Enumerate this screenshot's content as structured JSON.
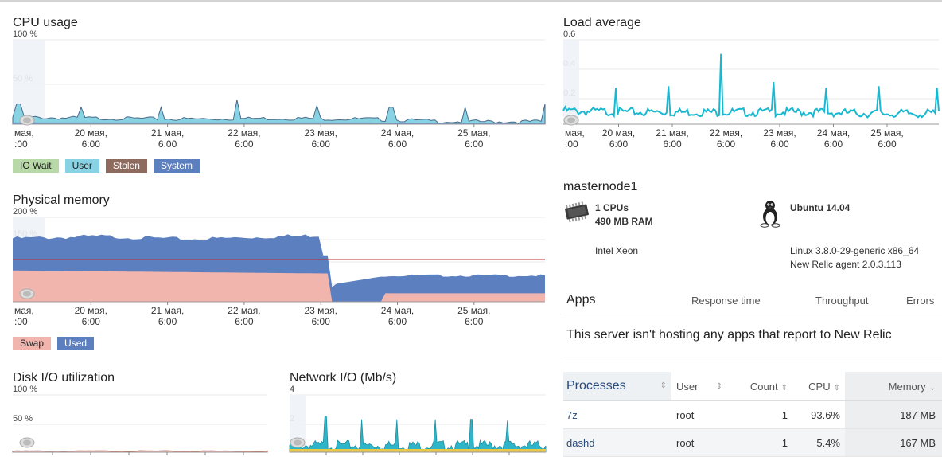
{
  "cpu": {
    "title": "CPU usage",
    "y_ticks": [
      "100 %",
      "50 %"
    ],
    "legend": [
      {
        "label": "IO Wait",
        "color": "#b7d9a7"
      },
      {
        "label": "User",
        "color": "#87d3e3"
      },
      {
        "label": "Stolen",
        "color": "#8e6b5f"
      },
      {
        "label": "System",
        "color": "#5c7fbf"
      }
    ]
  },
  "x_axis": {
    "row1": [
      "мая,",
      "20 мая,",
      "21 мая,",
      "22 мая,",
      "23 мая,",
      "24 мая,",
      "25 мая,"
    ],
    "row2": [
      ":00",
      "6:00",
      "6:00",
      "6:00",
      "6:00",
      "6:00",
      "6:00"
    ]
  },
  "memory": {
    "title": "Physical memory",
    "y_ticks": [
      "200 %",
      "150 %",
      "100 %",
      "50 %"
    ],
    "legend": [
      {
        "label": "Swap",
        "color": "#f2b5ae"
      },
      {
        "label": "Used",
        "color": "#5c7fbf"
      }
    ]
  },
  "disk": {
    "title": "Disk I/O utilization",
    "y_ticks": [
      "100 %",
      "50 %"
    ]
  },
  "network": {
    "title": "Network I/O (Mb/s)",
    "y_ticks": [
      "4",
      "2"
    ]
  },
  "load": {
    "title": "Load average",
    "y_ticks": [
      "0.6",
      "0.4",
      "0.2"
    ]
  },
  "host": {
    "name": "masternode1",
    "cpus": "1 CPUs",
    "ram": "490 MB RAM",
    "os": "Ubuntu 14.04",
    "processor": "Intel Xeon",
    "kernel": "Linux 3.8.0-29-generic x86_64",
    "agent": "New Relic agent 2.0.3.113",
    "cpu_icon": "cpu-chip-icon",
    "os_icon": "linux-penguin-icon"
  },
  "apps": {
    "title": "Apps",
    "columns": [
      "Response time",
      "Throughput",
      "Errors"
    ],
    "message": "This server isn't hosting any apps that report to New Relic"
  },
  "processes": {
    "headers": [
      "Processes",
      "User",
      "Count",
      "CPU",
      "Memory"
    ],
    "rows": [
      {
        "name": "7z",
        "user": "root",
        "count": "1",
        "cpu": "93.6%",
        "memory": "187 MB"
      },
      {
        "name": "dashd",
        "user": "root",
        "count": "1",
        "cpu": "5.4%",
        "memory": "167 MB"
      }
    ]
  },
  "chart_data": [
    {
      "type": "area",
      "title": "CPU usage",
      "ylim": [
        0,
        100
      ],
      "y_unit": "%",
      "x": [
        "19 мая 6:00",
        "20 мая 6:00",
        "21 мая 6:00",
        "22 мая 6:00",
        "23 мая 6:00",
        "24 мая 6:00",
        "25 мая 6:00"
      ],
      "series": [
        {
          "name": "User",
          "values": [
            8,
            7,
            6,
            7,
            6,
            3,
            3
          ]
        },
        {
          "name": "System",
          "values": [
            2,
            2,
            2,
            2,
            2,
            1,
            1
          ]
        }
      ],
      "spikes_percent": [
        24,
        20,
        20,
        29,
        22,
        20,
        20,
        24
      ]
    },
    {
      "type": "area",
      "title": "Physical memory",
      "ylim": [
        0,
        200
      ],
      "y_unit": "%",
      "reference_line": 100,
      "x": [
        "19 мая 6:00",
        "20 мая 6:00",
        "21 мая 6:00",
        "22 мая 6:00",
        "23 мая 6:00",
        "24 мая 6:00",
        "25 мая 6:00"
      ],
      "series": [
        {
          "name": "Used",
          "values": [
            150,
            155,
            148,
            155,
            160,
            35,
            68
          ]
        },
        {
          "name": "Swap",
          "values": [
            74,
            72,
            70,
            68,
            66,
            0,
            20
          ]
        }
      ]
    },
    {
      "type": "line",
      "title": "Load average",
      "ylim": [
        0,
        0.6
      ],
      "x": [
        "19 мая 6:00",
        "20 мая 6:00",
        "21 мая 6:00",
        "22 мая 6:00",
        "23 мая 6:00",
        "24 мая 6:00",
        "25 мая 6:00"
      ],
      "series": [
        {
          "values": [
            0.08,
            0.07,
            0.07,
            0.07,
            0.07,
            0.06,
            0.06
          ]
        }
      ],
      "spikes": [
        0.26,
        0.27,
        0.5,
        0.3,
        0.26,
        0.27,
        0.26
      ]
    },
    {
      "type": "area",
      "title": "Disk I/O utilization",
      "ylim": [
        0,
        100
      ],
      "y_unit": "%",
      "series": [
        {
          "values": [
            2,
            2,
            2,
            2,
            2,
            2,
            2
          ]
        }
      ]
    },
    {
      "type": "area",
      "title": "Network I/O (Mb/s)",
      "ylim": [
        0,
        4
      ],
      "series": [
        {
          "values": [
            0.3,
            0.3,
            0.3,
            0.3,
            0.3,
            0.3,
            0.3
          ]
        }
      ],
      "spikes": [
        2.5,
        2.3,
        2.3,
        2.3,
        2.3,
        2.2
      ]
    }
  ]
}
